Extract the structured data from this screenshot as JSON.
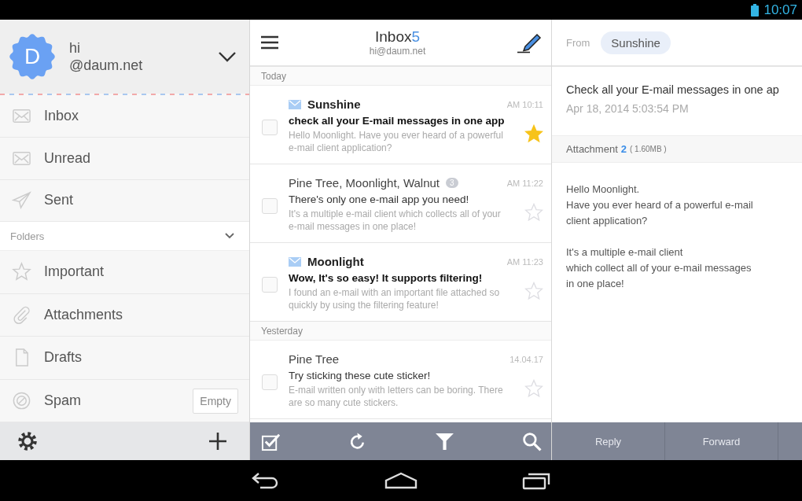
{
  "status_bar": {
    "time": "10:07"
  },
  "sidebar": {
    "account": {
      "avatar_letter": "D",
      "name": "hi",
      "email": "@daum.net"
    },
    "items": [
      {
        "label": "Inbox"
      },
      {
        "label": "Unread"
      },
      {
        "label": "Sent"
      }
    ],
    "folders": {
      "label": "Folders",
      "expanded": true,
      "items": [
        {
          "label": "Important"
        },
        {
          "label": "Attachments"
        },
        {
          "label": "Drafts"
        },
        {
          "label": "Spam",
          "action": "Empty"
        }
      ]
    }
  },
  "message_list": {
    "title": "Inbox",
    "unread_count": "5",
    "account": "hi@daum.net",
    "groups": [
      {
        "label": "Today",
        "messages": [
          {
            "sender": "Sunshine",
            "time": "AM 10:11",
            "subject": "check all your E-mail messages in one app",
            "preview": "Hello Moonlight. Have you ever heard of a powerful e-mail client application?",
            "unread": true,
            "starred": true,
            "checked": false
          },
          {
            "sender": "Pine Tree, Moonlight, Walnut",
            "thread_count": "3",
            "time": "AM 11:22",
            "subject": "There's only one e-mail app you need!",
            "preview": "It's a multiple e-mail client which collects all of your e-mail messages in one place!",
            "unread": false,
            "starred": false,
            "checked": false
          },
          {
            "sender": "Moonlight",
            "time": "AM 11:23",
            "subject": "Wow, It's so easy! It supports filtering!",
            "preview": "I found an e-mail with an important file attached so quickly by using the filtering feature!",
            "unread": true,
            "starred": false,
            "checked": false
          }
        ]
      },
      {
        "label": "Yesterday",
        "messages": [
          {
            "sender": "Pine Tree",
            "time": "14.04.17",
            "subject": "Try sticking these cute sticker!",
            "preview": "E-mail written only with letters can be boring. There are so many cute stickers.",
            "unread": false,
            "starred": false,
            "checked": false
          }
        ]
      }
    ]
  },
  "reader": {
    "from_label": "From",
    "from": "Sunshine",
    "subject": "Check all your E-mail messages in one ap",
    "date": "Apr 18, 2014 5:03:54 PM",
    "attachment": {
      "label": "Attachment",
      "count": "2",
      "size": "( 1.60MB )"
    },
    "body": [
      "Hello Moonlight.\nHave you ever heard of a powerful e-mail\nclient application?",
      "It's a multiple e-mail client\nwhich collect all of your e-mail messages\nin one place!"
    ],
    "actions": [
      "Reply",
      "Forward"
    ]
  }
}
